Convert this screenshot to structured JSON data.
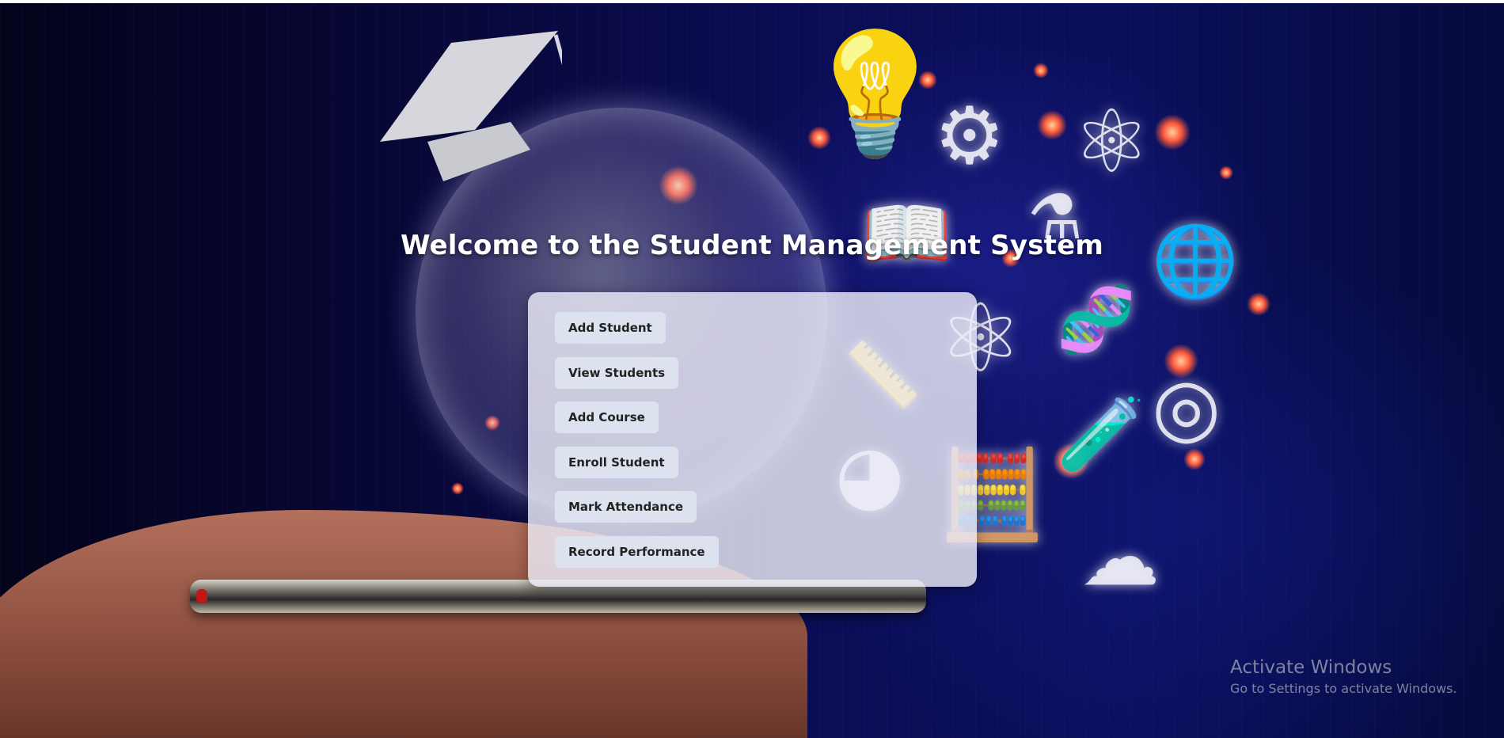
{
  "header": {
    "title": "Welcome to the Student Management System"
  },
  "menu": {
    "buttons": [
      {
        "label": "Add Student"
      },
      {
        "label": "View Students"
      },
      {
        "label": "Add Course"
      },
      {
        "label": "Enroll Student"
      },
      {
        "label": "Mark Attendance"
      },
      {
        "label": "Record Performance"
      }
    ]
  },
  "watermark": {
    "title": "Activate Windows",
    "subtitle": "Go to Settings to activate Windows."
  },
  "background": {
    "icons": [
      "graduation-cap-icon",
      "globe-icon",
      "lightbulb-icon",
      "gear-icon",
      "atom-icon",
      "flask-icon",
      "book-icon",
      "dna-icon",
      "target-icon",
      "test-tube-icon",
      "ruler-icon",
      "pie-chart-icon",
      "calculator-icon",
      "cloud-icon"
    ]
  },
  "colors": {
    "background": "#0a0f5a",
    "panel": "#ebebf8",
    "button": "#dde3ee",
    "button_text": "#222222",
    "title_text": "#ffffff"
  }
}
